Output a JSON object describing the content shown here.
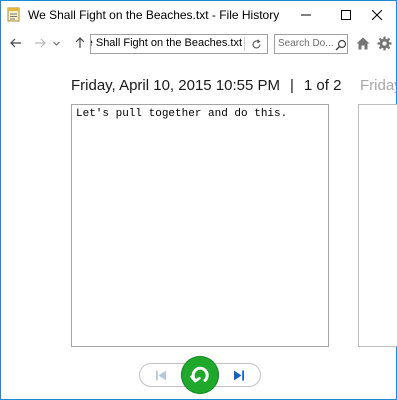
{
  "window": {
    "title": "We Shall Fight on the Beaches.txt - File History"
  },
  "nav": {
    "address": "We Shall Fight on the Beaches.txt",
    "search_placeholder": "Search Do..."
  },
  "version": {
    "date": "Friday, April 10, 2015 10:55 PM",
    "separator": "|",
    "position": "1 of 2",
    "next_date": "Friday,"
  },
  "file": {
    "content": "Let's pull together and do this."
  },
  "icons": {
    "app": "notepad-file-icon",
    "back": "arrow-left-icon",
    "forward": "arrow-right-icon",
    "recent": "chevron-down-icon",
    "up": "arrow-up-icon",
    "refresh": "refresh-icon",
    "search": "search-icon",
    "home": "home-icon",
    "settings": "gear-icon",
    "previous": "skip-previous-icon",
    "restore": "restore-icon",
    "next": "skip-next-icon"
  },
  "colors": {
    "accent_border": "#1a8ad4",
    "restore_green": "#1fa82b",
    "nav_blue": "#1565c0"
  }
}
